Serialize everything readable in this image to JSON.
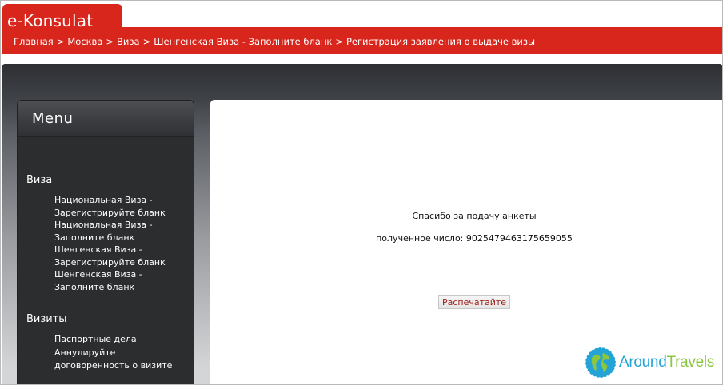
{
  "header": {
    "logo": "e-Konsulat",
    "breadcrumb": [
      "Главная",
      "Москва",
      "Виза",
      "Шенгенская Виза - Заполните бланк",
      "Регистрация заявления о выдаче визы"
    ],
    "separator": ">"
  },
  "sidebar": {
    "title": "Menu",
    "sections": [
      {
        "title": "Виза",
        "items": [
          {
            "line1": "Национальная Виза -",
            "line2": "Зарегистрируйте бланк"
          },
          {
            "line1": "Национальная Виза -",
            "line2": "Заполните бланк"
          },
          {
            "line1": "Шенгенская Виза -",
            "line2": "Зарегистрируйте бланк"
          },
          {
            "line1": "Шенгенская Виза -",
            "line2": "Заполните бланк"
          }
        ]
      },
      {
        "title": "Визиты",
        "items": [
          {
            "line1": "Паспортные дела",
            "line2": ""
          },
          {
            "line1": "Аннулируйте",
            "line2": "договоренность о визите"
          }
        ]
      }
    ]
  },
  "content": {
    "thanks": "Спасибо за подачу анкеты",
    "number_label": "полученное число:",
    "number_value": "9025479463175659055",
    "print_button": "Распечатайте"
  },
  "watermark": {
    "part1": "Around",
    "part2": "Travels"
  },
  "colors": {
    "brand_red": "#d9261c",
    "sidebar_dark": "#2c2d2e",
    "watermark_blue": "#24a4d6",
    "watermark_green": "#8cc63f"
  }
}
